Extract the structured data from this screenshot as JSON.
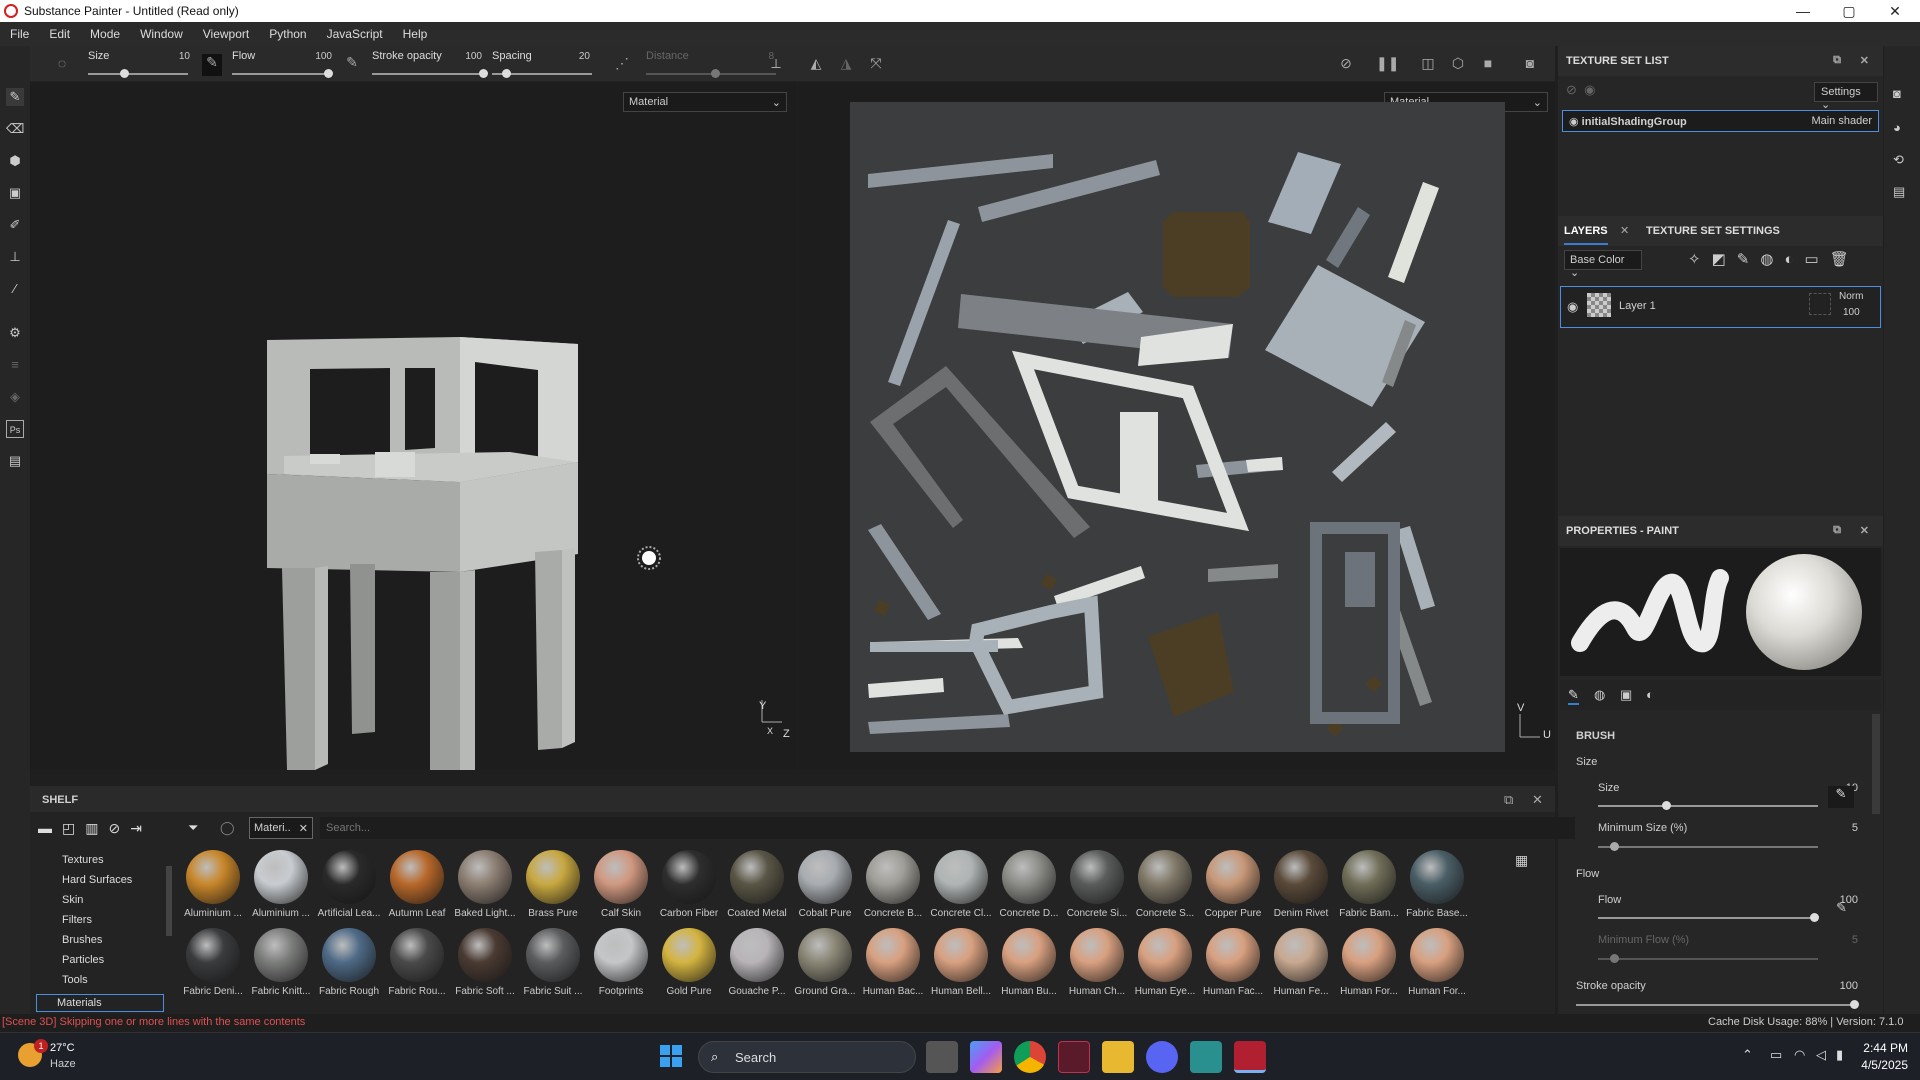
{
  "window": {
    "title": "Substance Painter - Untitled (Read only)",
    "min": "—",
    "max": "▢",
    "close": "✕"
  },
  "menu": [
    "File",
    "Edit",
    "Mode",
    "Window",
    "Viewport",
    "Python",
    "JavaScript",
    "Help"
  ],
  "toolbar": {
    "size_label": "Size",
    "size_value": "10",
    "flow_label": "Flow",
    "flow_value": "100",
    "opacity_label": "Stroke opacity",
    "opacity_value": "100",
    "spacing_label": "Spacing",
    "spacing_value": "20",
    "distance_label": "Distance",
    "distance_value": "8"
  },
  "viewport": {
    "left_mode": "Material",
    "right_mode": "Material",
    "axis3d_y": "Y",
    "axis3d_z": "Z",
    "axis3d_x": "X",
    "axis2d_v": "V",
    "axis2d_u": "U"
  },
  "texture_set_list": {
    "title": "TEXTURE SET LIST",
    "settings": "Settings",
    "set_name": "initialShadingGroup",
    "shader": "Main shader"
  },
  "layers": {
    "tab_layers": "LAYERS",
    "tab_settings": "TEXTURE SET SETTINGS",
    "channel": "Base Color",
    "layer_name": "Layer 1",
    "blend": "Norm",
    "opacity": "100"
  },
  "properties": {
    "title": "PROPERTIES - PAINT",
    "section": "BRUSH",
    "size_group": "Size",
    "size_label": "Size",
    "size_value": "10",
    "minsize_label": "Minimum Size (%)",
    "minsize_value": "5",
    "flow_group": "Flow",
    "flow_label": "Flow",
    "flow_value": "100",
    "minflow_label": "Minimum Flow (%)",
    "minflow_value": "5",
    "opacity_label": "Stroke opacity",
    "opacity_value": "100"
  },
  "shelf": {
    "title": "SHELF",
    "filter_tag": "Materi..",
    "search_placeholder": "Search...",
    "categories": [
      "Textures",
      "Hard Surfaces",
      "Skin",
      "Filters",
      "Brushes",
      "Particles",
      "Tools",
      "Materials"
    ],
    "row1": [
      "Aluminium ...",
      "Aluminium ...",
      "Artificial Lea...",
      "Autumn Leaf",
      "Baked Light...",
      "Brass Pure",
      "Calf Skin",
      "Carbon Fiber",
      "Coated Metal",
      "Cobalt Pure",
      "Concrete B...",
      "Concrete Cl...",
      "Concrete D...",
      "Concrete Si...",
      "Concrete S...",
      "Copper Pure",
      "Denim Rivet",
      "Fabric Bam...",
      "Fabric Base..."
    ],
    "row2": [
      "Fabric Deni...",
      "Fabric Knitt...",
      "Fabric Rough",
      "Fabric Rou...",
      "Fabric Soft ...",
      "Fabric Suit ...",
      "Footprints",
      "Gold Pure",
      "Gouache P...",
      "Ground Gra...",
      "Human Bac...",
      "Human Bell...",
      "Human Bu...",
      "Human Ch...",
      "Human Eye...",
      "Human Fac...",
      "Human Fe...",
      "Human For...",
      "Human For..."
    ]
  },
  "status": {
    "message": "[Scene 3D] Skipping one or more lines with the same contents",
    "cache": "Cache Disk Usage:  88% | Version: 7.1.0"
  },
  "taskbar": {
    "temp": "27°C",
    "weather": "Haze",
    "search": "Search",
    "time": "2:44 PM",
    "date": "4/5/2025",
    "badge": "1"
  }
}
